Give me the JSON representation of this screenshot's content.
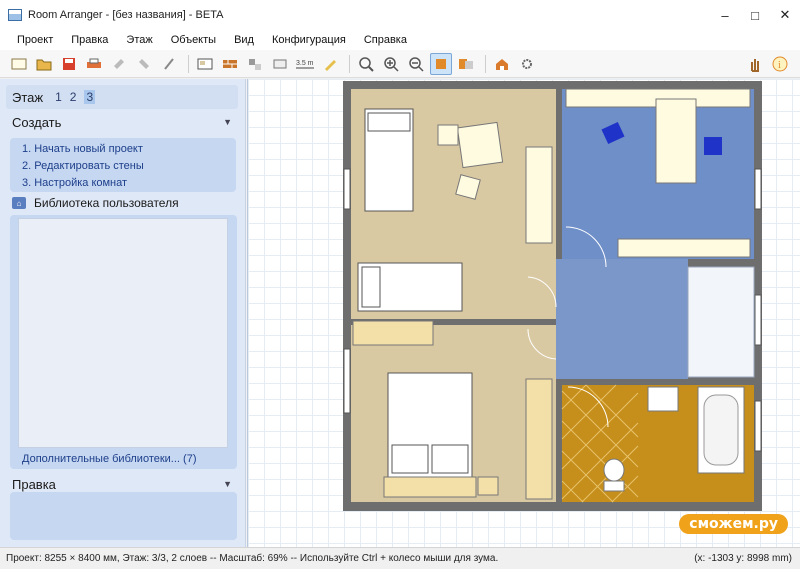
{
  "window": {
    "title": "Room Arranger - [без названия] - BETA"
  },
  "menu": [
    "Проект",
    "Правка",
    "Этаж",
    "Объекты",
    "Вид",
    "Конфигурация",
    "Справка"
  ],
  "floor": {
    "label": "Этаж",
    "numbers": [
      "1",
      "2",
      "3"
    ],
    "selected": "3"
  },
  "create": {
    "title": "Создать",
    "links": [
      "1. Начать новый проект",
      "2. Редактировать стены",
      "3. Настройка комнат"
    ]
  },
  "library": {
    "title": "Библиотека пользователя",
    "more": "Дополнительные библиотеки... (7)"
  },
  "edit": {
    "title": "Правка"
  },
  "status": {
    "left": "Проект: 8255 × 8400 мм, Этаж: 3/3, 2 слоев -- Масштаб: 69% -- Используйте Ctrl + колесо мыши для зума.",
    "right": "(x: -1303 y: 8998 mm)"
  },
  "watermark": "сможем.ру",
  "plan": {
    "dimension_label": "3.5 m"
  },
  "colors": {
    "carpet": "#d9c9a3",
    "blue_room": "#6f8fc9",
    "bathroom": "#c68f1c",
    "wall": "#6e6e6e"
  }
}
